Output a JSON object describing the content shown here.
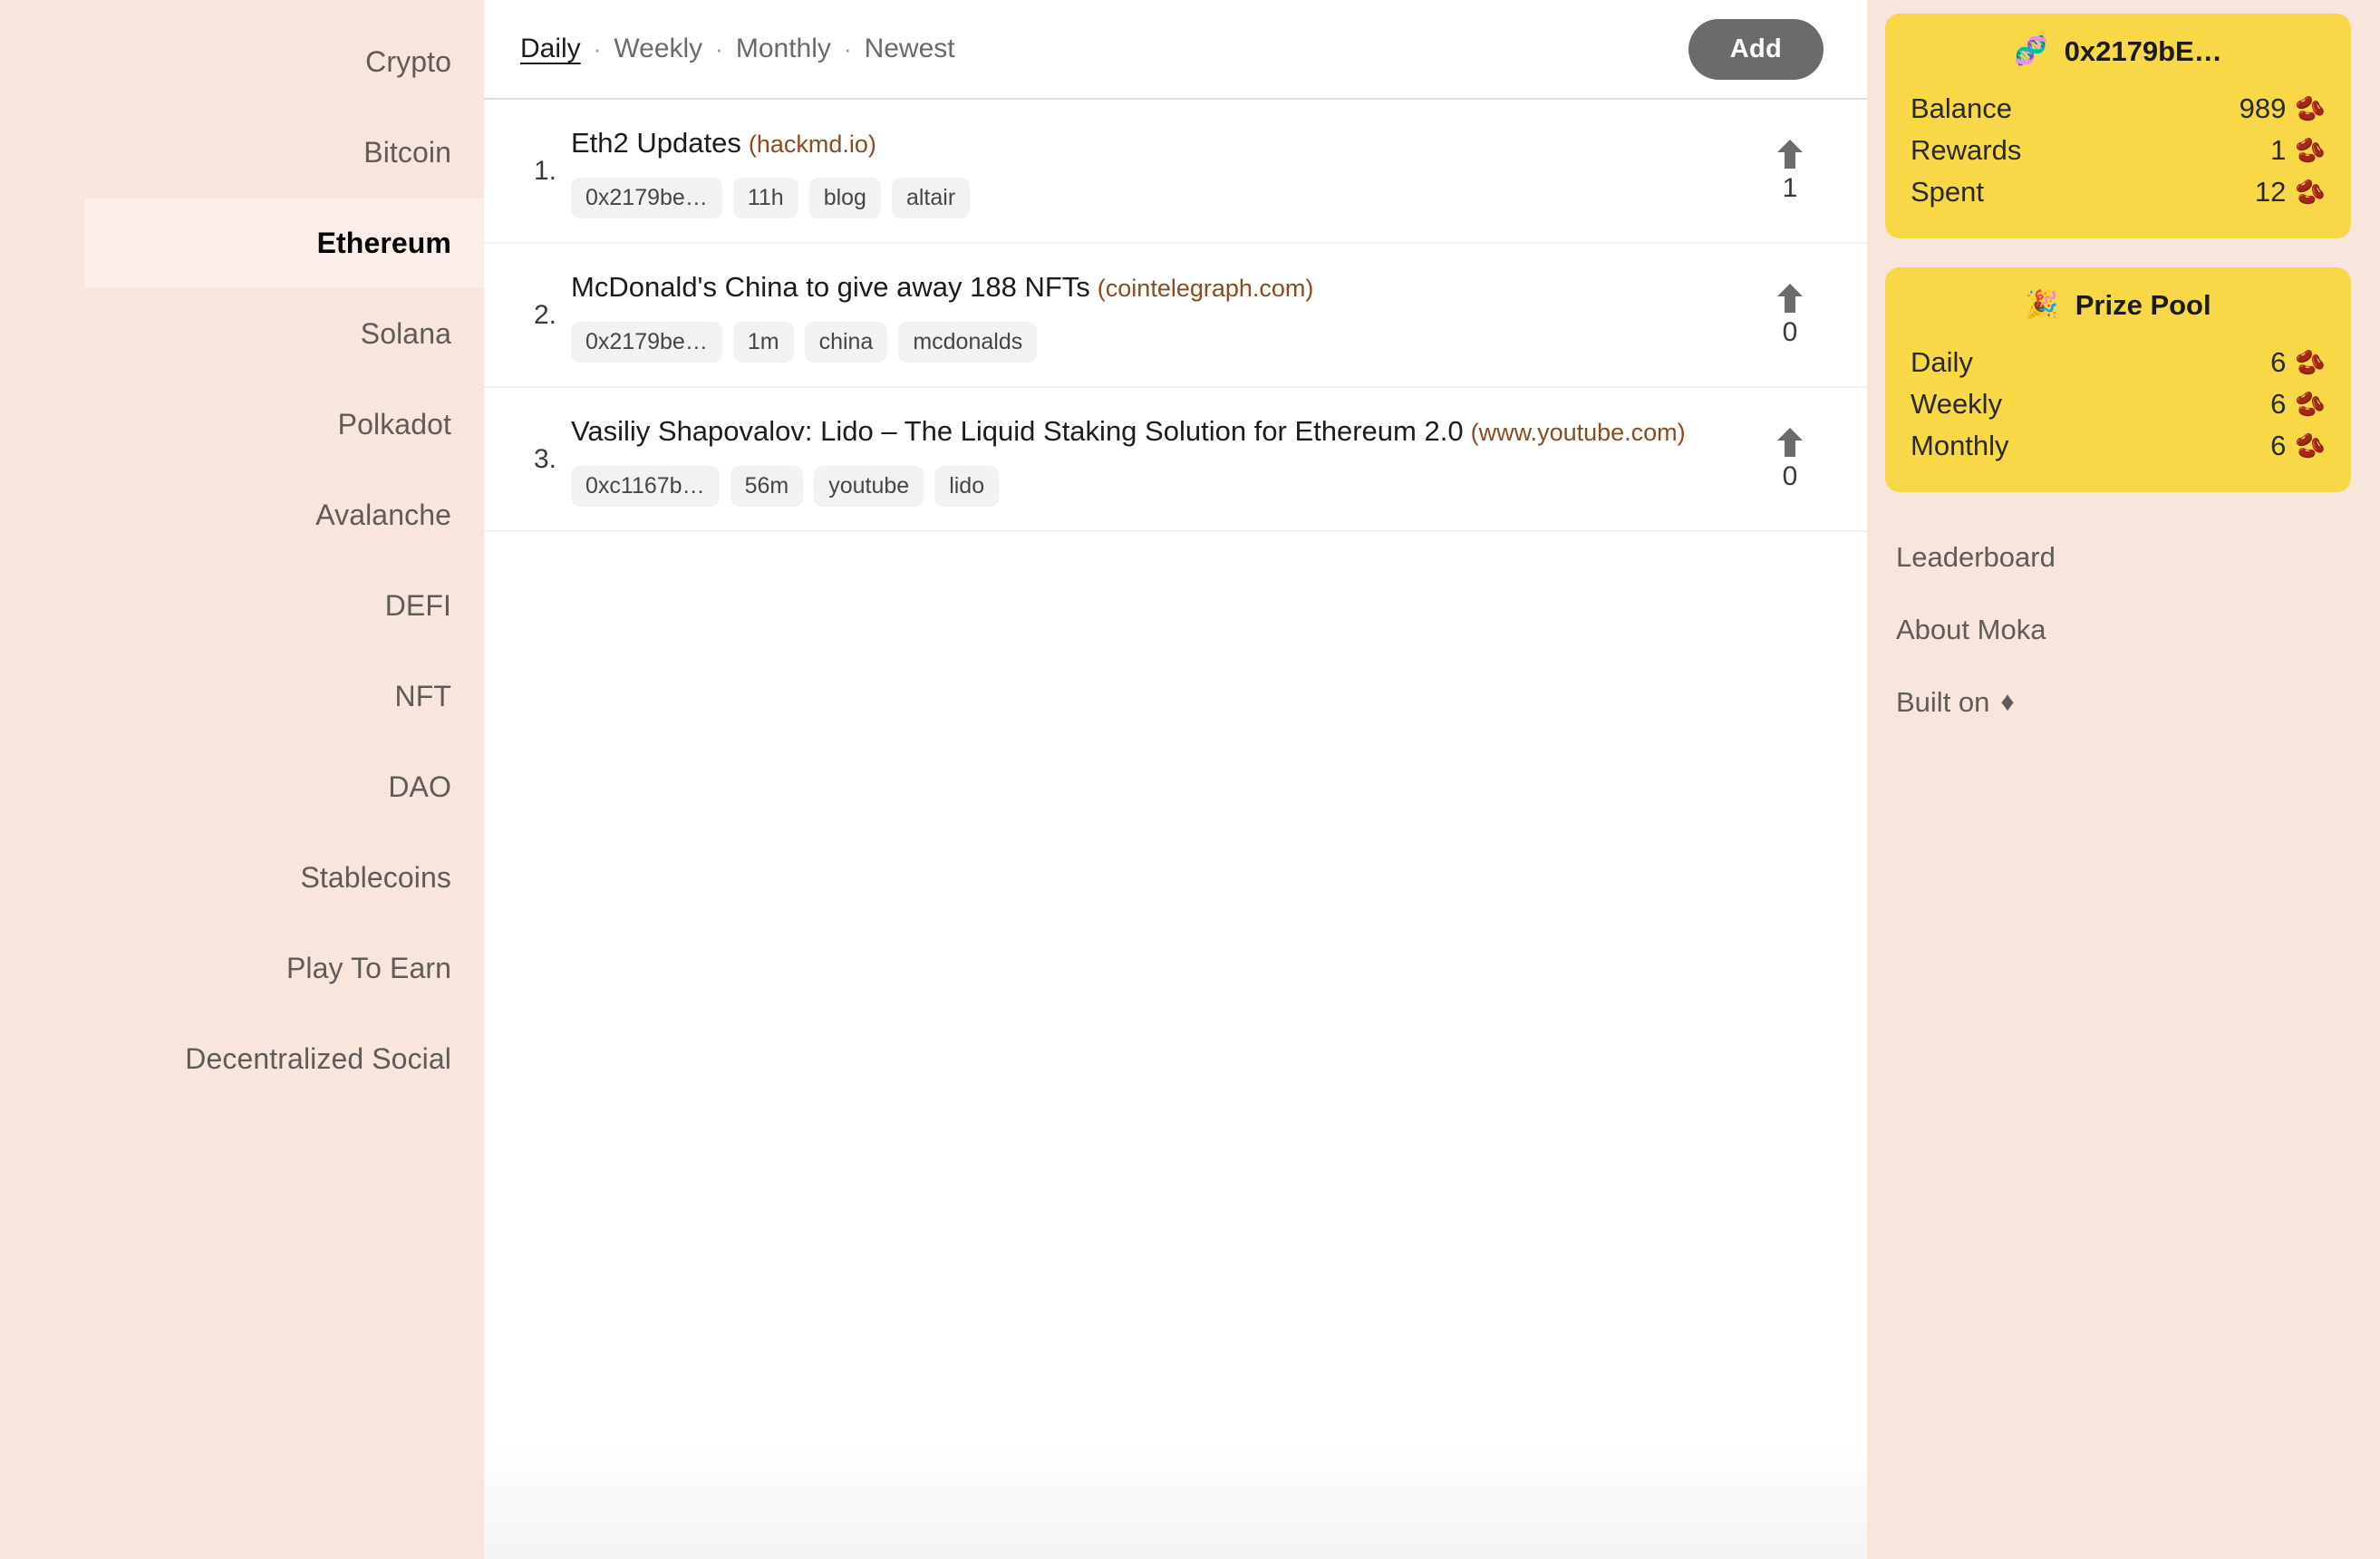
{
  "sidebar": {
    "items": [
      {
        "label": "Crypto",
        "active": false
      },
      {
        "label": "Bitcoin",
        "active": false
      },
      {
        "label": "Ethereum",
        "active": true
      },
      {
        "label": "Solana",
        "active": false
      },
      {
        "label": "Polkadot",
        "active": false
      },
      {
        "label": "Avalanche",
        "active": false
      },
      {
        "label": "DEFI",
        "active": false
      },
      {
        "label": "NFT",
        "active": false
      },
      {
        "label": "DAO",
        "active": false
      },
      {
        "label": "Stablecoins",
        "active": false
      },
      {
        "label": "Play To Earn",
        "active": false
      },
      {
        "label": "Decentralized Social",
        "active": false
      }
    ]
  },
  "toolbar": {
    "filters": [
      {
        "label": "Daily",
        "active": true
      },
      {
        "label": "Weekly",
        "active": false
      },
      {
        "label": "Monthly",
        "active": false
      },
      {
        "label": "Newest",
        "active": false
      }
    ],
    "separator": "·",
    "add_label": "Add"
  },
  "posts": [
    {
      "rank": "1.",
      "title": "Eth2 Updates",
      "domain": "(hackmd.io)",
      "tags": [
        "0x2179be…",
        "11h",
        "blog",
        "altair"
      ],
      "votes": "1",
      "upvote_icon": "arrow-up-icon"
    },
    {
      "rank": "2.",
      "title": "McDonald's China to give away 188 NFTs",
      "domain": "(cointelegraph.com)",
      "tags": [
        "0x2179be…",
        "1m",
        "china",
        "mcdonalds"
      ],
      "votes": "0",
      "upvote_icon": "arrow-up-icon"
    },
    {
      "rank": "3.",
      "title": "Vasiliy Shapovalov: Lido – The Liquid Staking Solution for Ethereum 2.0",
      "domain": "(www.youtube.com)",
      "tags": [
        "0xc1167b…",
        "56m",
        "youtube",
        "lido"
      ],
      "votes": "0",
      "upvote_icon": "arrow-up-icon"
    }
  ],
  "wallet_card": {
    "emoji": "🧬",
    "emoji_name": "dna-icon",
    "address": "0x2179bE…",
    "rows": [
      {
        "label": "Balance",
        "value": "989",
        "unit": "🫘"
      },
      {
        "label": "Rewards",
        "value": "1",
        "unit": "🫘"
      },
      {
        "label": "Spent",
        "value": "12",
        "unit": "🫘"
      }
    ]
  },
  "prize_card": {
    "emoji": "🎉",
    "emoji_name": "party-popper-icon",
    "title": "Prize Pool",
    "rows": [
      {
        "label": "Daily",
        "value": "6",
        "unit": "🫘"
      },
      {
        "label": "Weekly",
        "value": "6",
        "unit": "🫘"
      },
      {
        "label": "Monthly",
        "value": "6",
        "unit": "🫘"
      }
    ]
  },
  "side_links": [
    {
      "label": "Leaderboard",
      "glyph": ""
    },
    {
      "label": "About Moka",
      "glyph": ""
    },
    {
      "label": "Built on",
      "glyph": "♦"
    }
  ],
  "colors": {
    "page_background": "#f8e6dc",
    "content_background": "#ffffff",
    "card_yellow": "#f8d847",
    "accent_domain": "#8a4b22",
    "add_button": "#6b6b6b",
    "active_nav_background": "#fbeee9"
  }
}
